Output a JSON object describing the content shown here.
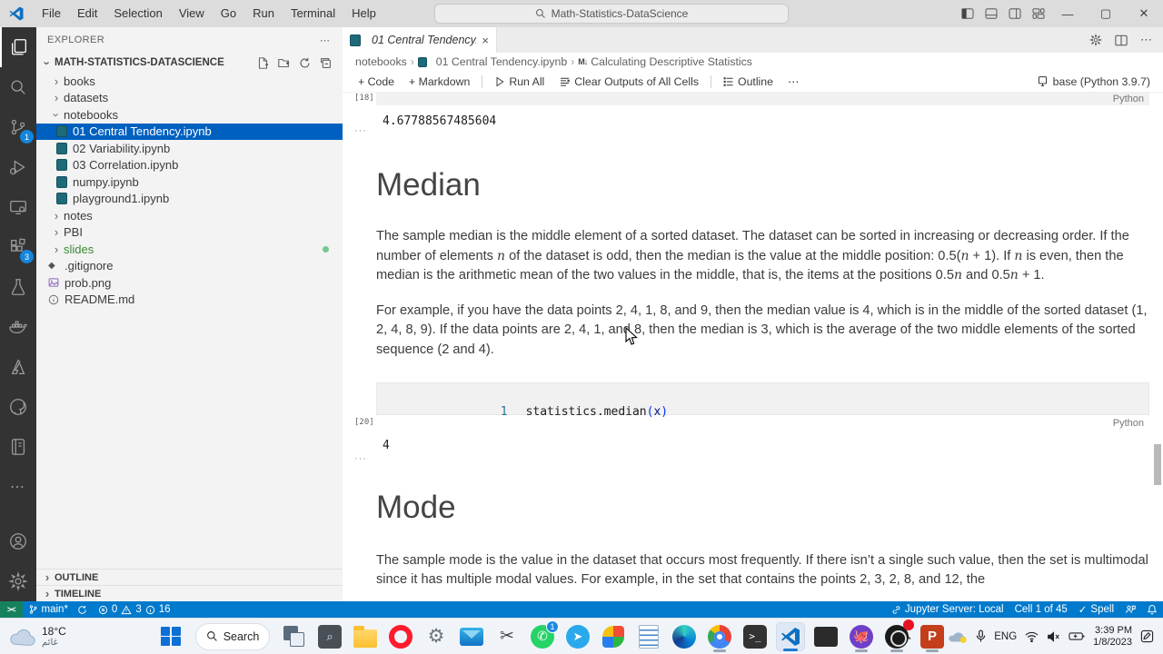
{
  "colors": {
    "accent": "#007acc",
    "remote_green": "#16825d",
    "selection_blue": "#0060c0",
    "badge_blue": "#1585dc",
    "activitybar_bg": "#333333",
    "sidebar_bg": "#f3f3f3",
    "cell_bg": "#f1f1f1"
  },
  "titlebar": {
    "menus": [
      "File",
      "Edit",
      "Selection",
      "View",
      "Go",
      "Run",
      "Terminal",
      "Help"
    ],
    "search_text": "Math-Statistics-DataScience"
  },
  "activity_bar": {
    "items": [
      {
        "icon": "explorer-icon",
        "active": true
      },
      {
        "icon": "search-icon"
      },
      {
        "icon": "source-control-icon",
        "badge": "1"
      },
      {
        "icon": "run-debug-icon"
      },
      {
        "icon": "remote-explorer-icon"
      },
      {
        "icon": "extensions-icon",
        "badge": "3"
      },
      {
        "icon": "testing-flask-icon"
      },
      {
        "icon": "docker-icon"
      },
      {
        "icon": "azure-icon"
      },
      {
        "icon": "github-icon"
      },
      {
        "icon": "notebook-icon"
      },
      {
        "icon": "more-icon"
      }
    ],
    "bottom": [
      {
        "icon": "account-icon"
      },
      {
        "icon": "settings-gear-icon"
      }
    ]
  },
  "sidebar": {
    "header": "EXPLORER",
    "project": "MATH-STATISTICS-DATASCIENCE",
    "tree": [
      {
        "label": "books",
        "kind": "folder",
        "expanded": false
      },
      {
        "label": "datasets",
        "kind": "folder",
        "expanded": false
      },
      {
        "label": "notebooks",
        "kind": "folder",
        "expanded": true
      },
      {
        "label": "01 Central Tendency.ipynb",
        "kind": "file",
        "icon": "notebook-file-icon",
        "nested": true,
        "selected": true
      },
      {
        "label": "02 Variability.ipynb",
        "kind": "file",
        "icon": "notebook-file-icon",
        "nested": true
      },
      {
        "label": "03 Correlation.ipynb",
        "kind": "file",
        "icon": "notebook-file-icon",
        "nested": true
      },
      {
        "label": "numpy.ipynb",
        "kind": "file",
        "icon": "notebook-file-icon",
        "nested": true
      },
      {
        "label": "playground1.ipynb",
        "kind": "file",
        "icon": "notebook-file-icon",
        "nested": true
      },
      {
        "label": "notes",
        "kind": "folder",
        "expanded": false
      },
      {
        "label": "PBI",
        "kind": "folder",
        "expanded": false
      },
      {
        "label": "slides",
        "kind": "folder",
        "expanded": false,
        "color": "#388a34",
        "dot": true
      },
      {
        "label": ".gitignore",
        "kind": "file",
        "icon": "gitignore-file-icon"
      },
      {
        "label": "prob.png",
        "kind": "file",
        "icon": "image-file-icon"
      },
      {
        "label": "README.md",
        "kind": "file",
        "icon": "readme-file-icon"
      }
    ],
    "panels": {
      "outline": "OUTLINE",
      "timeline": "TIMELINE"
    }
  },
  "editor": {
    "tab": {
      "label": "01 Central Tendency.ipynb",
      "close": "×"
    },
    "breadcrumbs": [
      "notebooks",
      "01 Central Tendency.ipynb",
      "Calculating Descriptive Statistics"
    ],
    "markdown_glyph": "M↓",
    "toolbar": {
      "code": "+ Code",
      "markdown": "+ Markdown",
      "run_all": "Run All",
      "clear_outputs": "Clear Outputs of All Cells",
      "outline": "Outline",
      "more": "⋯",
      "kernel": "base (Python 3.9.7)"
    }
  },
  "notebook": {
    "cells": [
      {
        "type": "code-partial",
        "exec": "[18]",
        "lang": "Python",
        "output": "4.67788567485604"
      },
      {
        "type": "markdown",
        "heading": "Median",
        "paragraphs": [
          [
            {
              "t": "The sample median is the middle element of a sorted dataset. The dataset can be sorted in increasing or decreasing order. If the number of elements "
            },
            {
              "math": "n"
            },
            {
              "t": " of the dataset is odd, then the median is the value at the middle position: 0.5("
            },
            {
              "math": "n"
            },
            {
              "t": " + 1). If "
            },
            {
              "math": "n"
            },
            {
              "t": " is even, then the median is the arithmetic mean of the two values in the middle, that is, the items at the positions 0.5"
            },
            {
              "math": "n"
            },
            {
              "t": " and 0.5"
            },
            {
              "math": "n"
            },
            {
              "t": " + 1."
            }
          ],
          [
            {
              "t": "For example, if you have the data points 2, 4, 1, 8, and 9, then the median value is 4, which is in the middle of the sorted dataset (1, 2, 4, 8, 9). If the data points are 2, 4, 1, and 8, then the median is 3, which is the average of the two middle elements of the sorted sequence (2 and 4)."
            }
          ]
        ]
      },
      {
        "type": "code",
        "exec": "[20]",
        "lang": "Python",
        "line_number": "1",
        "tokens": [
          {
            "t": "statistics.median",
            "c": "#1e1e1e"
          },
          {
            "t": "(",
            "c": "#0431fa"
          },
          {
            "t": "x",
            "c": "#001080"
          },
          {
            "t": ")",
            "c": "#0431fa"
          }
        ],
        "output": "4"
      },
      {
        "type": "markdown",
        "heading": "Mode",
        "paragraphs": [
          [
            {
              "t": "The sample mode is the value in the dataset that occurs most frequently. If there isn’t a single such value, then the set is multimodal since it has multiple modal values. For example, in the set that contains the points 2, 3, 2, 8, and 12, the"
            }
          ]
        ]
      }
    ]
  },
  "status_bar": {
    "branch": "main*",
    "errors": "0",
    "warnings": "3",
    "infos": "16",
    "jupyter": "Jupyter Server: Local",
    "cell_position": "Cell 1 of 45",
    "spell": "Spell"
  },
  "taskbar": {
    "weather": {
      "temp": "18°C",
      "condition": "غائم"
    },
    "search_label": "Search",
    "apps": [
      {
        "icon": "start-icon"
      },
      {
        "icon": "search-pill"
      },
      {
        "icon": "task-view-icon"
      },
      {
        "icon": "search-app-icon"
      },
      {
        "icon": "file-explorer-icon"
      },
      {
        "icon": "opera-icon"
      },
      {
        "icon": "settings-app-icon"
      },
      {
        "icon": "mail-icon"
      },
      {
        "icon": "snipping-tool-icon"
      },
      {
        "icon": "whatsapp-icon",
        "badge": "1"
      },
      {
        "icon": "telegram-icon"
      },
      {
        "icon": "colorful-app-icon"
      },
      {
        "icon": "notepad-icon"
      },
      {
        "icon": "edge-icon"
      },
      {
        "icon": "chrome-icon",
        "running": true
      },
      {
        "icon": "windows-terminal-icon"
      },
      {
        "icon": "vscode-icon",
        "active": true
      },
      {
        "icon": "cmd-icon"
      },
      {
        "icon": "github-desktop-icon",
        "running": true
      },
      {
        "icon": "obs-icon",
        "running": true,
        "alert": true
      },
      {
        "icon": "powerpoint-icon",
        "running": true
      }
    ],
    "tray": {
      "language": "ENG",
      "time": "3:39 PM",
      "date": "1/8/2023"
    }
  }
}
